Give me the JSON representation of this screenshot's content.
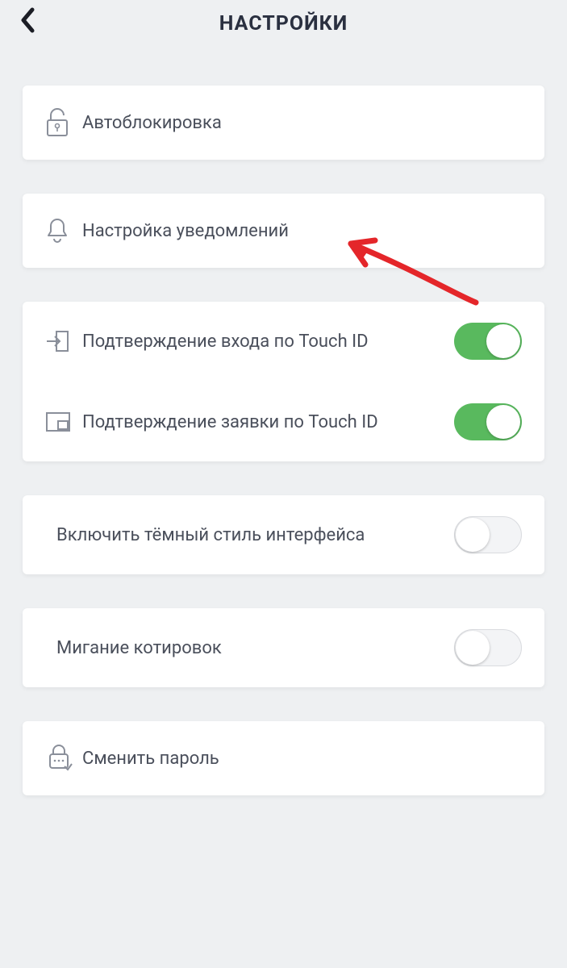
{
  "header": {
    "title": "НАСТРОЙКИ"
  },
  "rows": {
    "autolock": {
      "label": "Автоблокировка"
    },
    "notifications": {
      "label": "Настройка уведомлений"
    },
    "touchid_login": {
      "label": "Подтверждение входа по Touch ID",
      "enabled": true
    },
    "touchid_request": {
      "label": "Подтверждение заявки по Touch ID",
      "enabled": true
    },
    "dark_mode": {
      "label": "Включить тёмный стиль интерфейса",
      "enabled": false
    },
    "blink_quotes": {
      "label": "Мигание котировок",
      "enabled": false
    },
    "change_password": {
      "label": "Сменить пароль"
    }
  },
  "colors": {
    "accent_on": "#59b95e"
  }
}
